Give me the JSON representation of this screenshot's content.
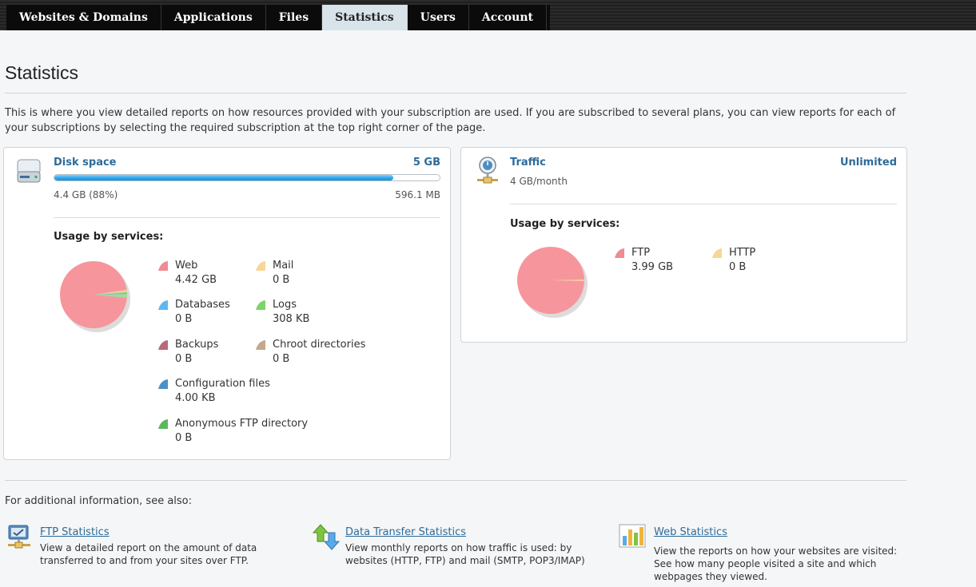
{
  "nav": {
    "tabs": [
      {
        "label": "Websites & Domains"
      },
      {
        "label": "Applications"
      },
      {
        "label": "Files"
      },
      {
        "label": "Statistics"
      },
      {
        "label": "Users"
      },
      {
        "label": "Account"
      }
    ],
    "active_tab": "Statistics"
  },
  "page": {
    "title": "Statistics",
    "intro": "This is where you view detailed reports on how resources provided with your subscription are used. If you are subscribed to several plans, you can view reports for each of your subscriptions by selecting the required subscription at the top right corner of the page."
  },
  "disk": {
    "icon": "hard-drive-icon",
    "title": "Disk space",
    "limit": "5 GB",
    "used": "4.4 GB (88%)",
    "free": "596.1 MB",
    "progress": 0.88,
    "usage_heading": "Usage by services:",
    "services": [
      {
        "name": "Web",
        "value": "4.42 GB",
        "color": "#f08a93"
      },
      {
        "name": "Mail",
        "value": "0 B",
        "color": "#f7d69a"
      },
      {
        "name": "Databases",
        "value": "0 B",
        "color": "#5bb8f0"
      },
      {
        "name": "Logs",
        "value": "308 KB",
        "color": "#7ed36b"
      },
      {
        "name": "Backups",
        "value": "0 B",
        "color": "#b86a78"
      },
      {
        "name": "Chroot directories",
        "value": "0 B",
        "color": "#c4a88c"
      },
      {
        "name": "Configuration files",
        "value": "4.00 KB",
        "color": "#4a90c8"
      },
      {
        "name": "Anonymous FTP directory",
        "value": "0 B",
        "color": "#5cb85c"
      }
    ]
  },
  "traffic": {
    "icon": "traffic-icon",
    "title": "Traffic",
    "limit": "Unlimited",
    "used": "4 GB/month",
    "usage_heading": "Usage by services:",
    "services": [
      {
        "name": "FTP",
        "value": "3.99 GB",
        "color": "#f08a93"
      },
      {
        "name": "HTTP",
        "value": "0 B",
        "color": "#f7d69a"
      }
    ]
  },
  "see_also": {
    "heading": "For additional information, see also:",
    "links": [
      {
        "icon": "ftp-statistics-icon",
        "title": "FTP Statistics",
        "desc": "View a detailed report on the amount of data transferred to and from your sites over FTP."
      },
      {
        "icon": "data-transfer-icon",
        "title": "Data Transfer Statistics",
        "desc": "View monthly reports on how traffic is used: by websites (HTTP, FTP) and mail (SMTP, POP3/IMAP)"
      },
      {
        "icon": "web-statistics-icon",
        "title": "Web Statistics",
        "desc": "View the reports on how your websites are visited: See how many people visited a site and which webpages they viewed."
      }
    ]
  }
}
